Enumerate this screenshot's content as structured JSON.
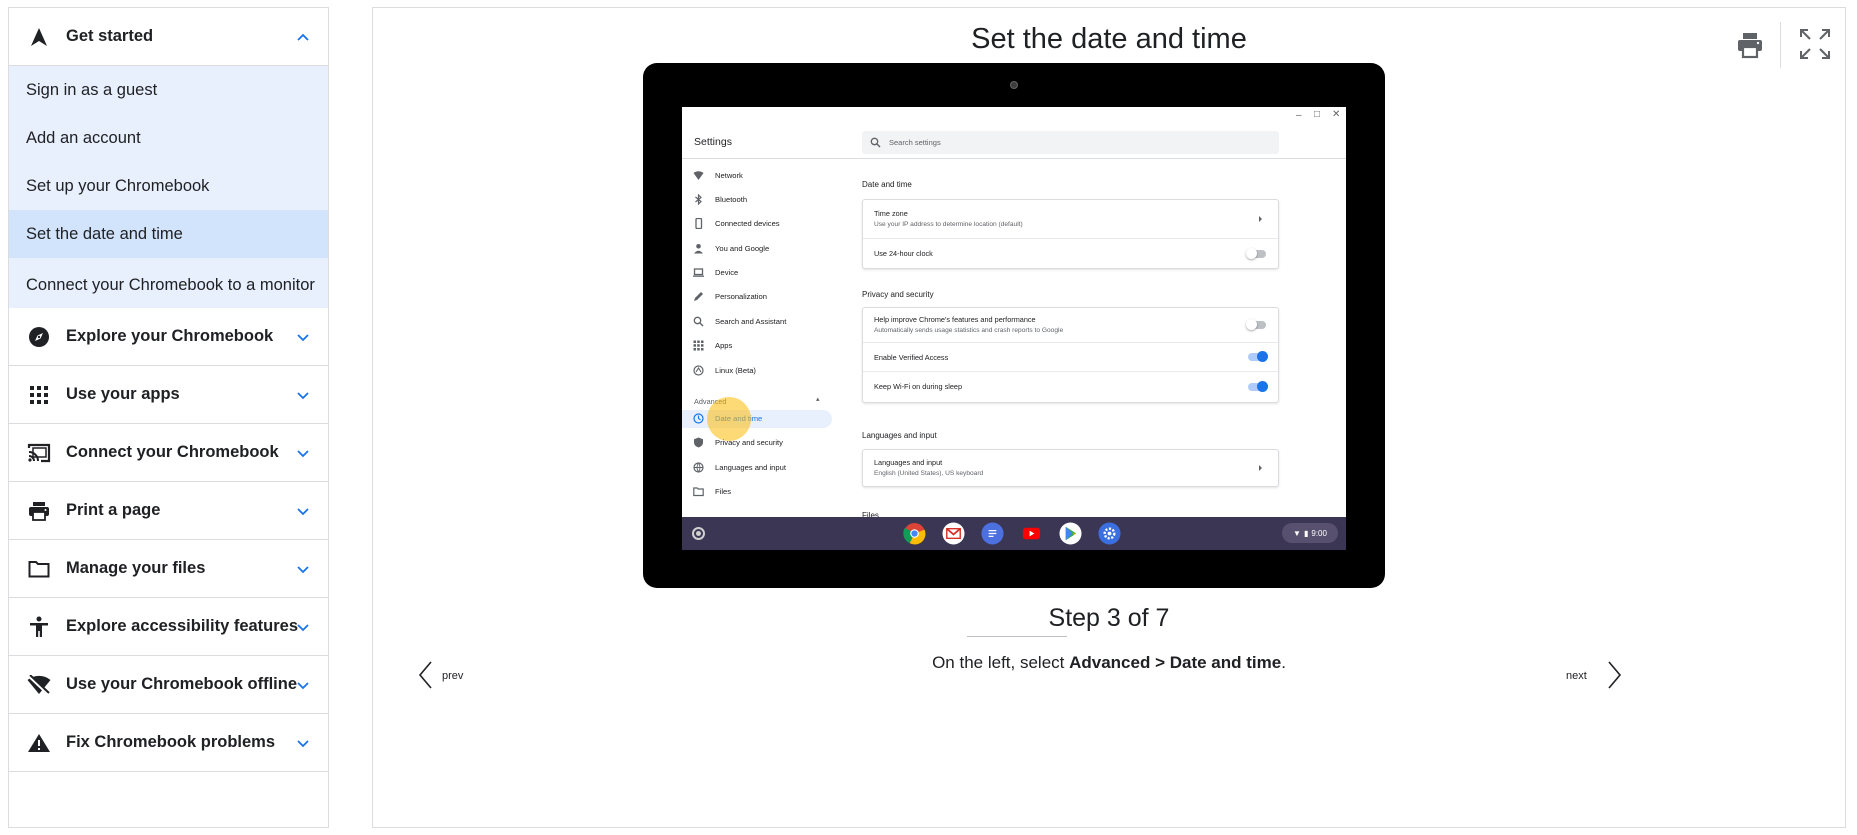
{
  "sidebar": {
    "sections": [
      {
        "label": "Get started",
        "icon": "navigation-arrow-icon",
        "expanded": true
      },
      {
        "label": "Explore your Chromebook",
        "icon": "compass-icon",
        "expanded": false
      },
      {
        "label": "Use your apps",
        "icon": "apps-grid-icon",
        "expanded": false
      },
      {
        "label": "Connect your Chromebook",
        "icon": "cast-icon",
        "expanded": false
      },
      {
        "label": "Print a page",
        "icon": "printer-icon",
        "expanded": false
      },
      {
        "label": "Manage your files",
        "icon": "folder-icon",
        "expanded": false
      },
      {
        "label": "Explore accessibility features",
        "icon": "accessibility-icon",
        "expanded": false
      },
      {
        "label": "Use your Chromebook offline",
        "icon": "wifi-off-icon",
        "expanded": false
      },
      {
        "label": "Fix Chromebook problems",
        "icon": "warning-icon",
        "expanded": false
      }
    ],
    "get_started_items": [
      {
        "label": "Sign in as a guest"
      },
      {
        "label": "Add an account"
      },
      {
        "label": "Set up your Chromebook"
      },
      {
        "label": "Set the date and time",
        "active": true
      },
      {
        "label": "Connect your Chromebook to a monitor"
      }
    ]
  },
  "main": {
    "title": "Set the date and time",
    "step_text": "Step 3 of 7",
    "instruction_prefix": "On the left, select ",
    "instruction_bold": "Advanced > Date and time",
    "instruction_suffix": ".",
    "prev_label": "prev",
    "next_label": "next"
  },
  "screenshot": {
    "settings_title": "Settings",
    "search_placeholder": "Search settings",
    "nav_items": [
      {
        "label": "Network",
        "icon": "wifi-icon"
      },
      {
        "label": "Bluetooth",
        "icon": "bluetooth-icon"
      },
      {
        "label": "Connected devices",
        "icon": "phone-icon"
      },
      {
        "label": "You and Google",
        "icon": "person-icon"
      },
      {
        "label": "Device",
        "icon": "laptop-icon"
      },
      {
        "label": "Personalization",
        "icon": "pen-icon"
      },
      {
        "label": "Search and Assistant",
        "icon": "search-icon"
      },
      {
        "label": "Apps",
        "icon": "apps-icon"
      },
      {
        "label": "Linux (Beta)",
        "icon": "linux-icon"
      }
    ],
    "advanced_label": "Advanced",
    "advanced_items": [
      {
        "label": "Date and time",
        "icon": "clock-icon",
        "selected": true
      },
      {
        "label": "Privacy and security",
        "icon": "shield-icon"
      },
      {
        "label": "Languages and input",
        "icon": "globe-icon"
      },
      {
        "label": "Files",
        "icon": "folder-icon"
      }
    ],
    "date_time_heading": "Date and time",
    "time_zone_title": "Time zone",
    "time_zone_sub": "Use your IP address to determine location (default)",
    "clock_24_label": "Use 24-hour clock",
    "privacy_heading": "Privacy and security",
    "help_improve_title": "Help improve Chrome's features and performance",
    "help_improve_sub": "Automatically sends usage statistics and crash reports to Google",
    "verified_access_label": "Enable Verified Access",
    "wifi_sleep_label": "Keep Wi-Fi on during sleep",
    "languages_heading": "Languages and input",
    "languages_title": "Languages and input",
    "languages_sub": "English (United States), US keyboard",
    "files_heading": "Files",
    "tray_time": "9:00",
    "shelf_apps": [
      {
        "name": "chrome-icon",
        "color": "#ffffff"
      },
      {
        "name": "gmail-icon",
        "color": "#ffffff"
      },
      {
        "name": "docs-icon",
        "color": "#4c70e0"
      },
      {
        "name": "youtube-icon",
        "color": "#3c3655"
      },
      {
        "name": "play-store-icon",
        "color": "#ffffff"
      },
      {
        "name": "settings-icon",
        "color": "#3b6fe0"
      }
    ]
  },
  "colors": {
    "accent": "#1a73e8",
    "sub_bg": "#e8f0fe",
    "active_bg": "#d2e3fc",
    "highlight": "#fbbc04"
  }
}
